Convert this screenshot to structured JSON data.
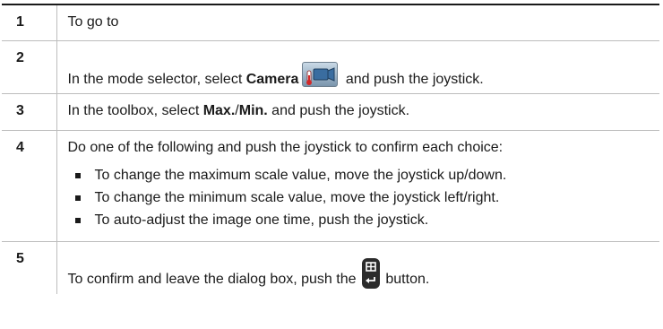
{
  "steps": [
    {
      "number": "1",
      "text": "To go to"
    },
    {
      "number": "2",
      "pre": "In the mode selector, select ",
      "bold": "Camera",
      "post": " and push the joystick.",
      "icon": "camera-mode-icon"
    },
    {
      "number": "3",
      "pre": "In the toolbox, select ",
      "bold1": "Max.",
      "sep": "/",
      "bold2": "Min.",
      "post": " and push the joystick."
    },
    {
      "number": "4",
      "text": "Do one of the following and push the joystick to confirm each choice:",
      "bullets": [
        "To change the maximum scale value, move the joystick up/down.",
        "To change the minimum scale value, move the joystick left/right.",
        "To auto-adjust the image one time, push the joystick."
      ]
    },
    {
      "number": "5",
      "pre": "To confirm and leave the dialog box, push the ",
      "post": " button.",
      "icon": "exit-button-icon"
    }
  ]
}
